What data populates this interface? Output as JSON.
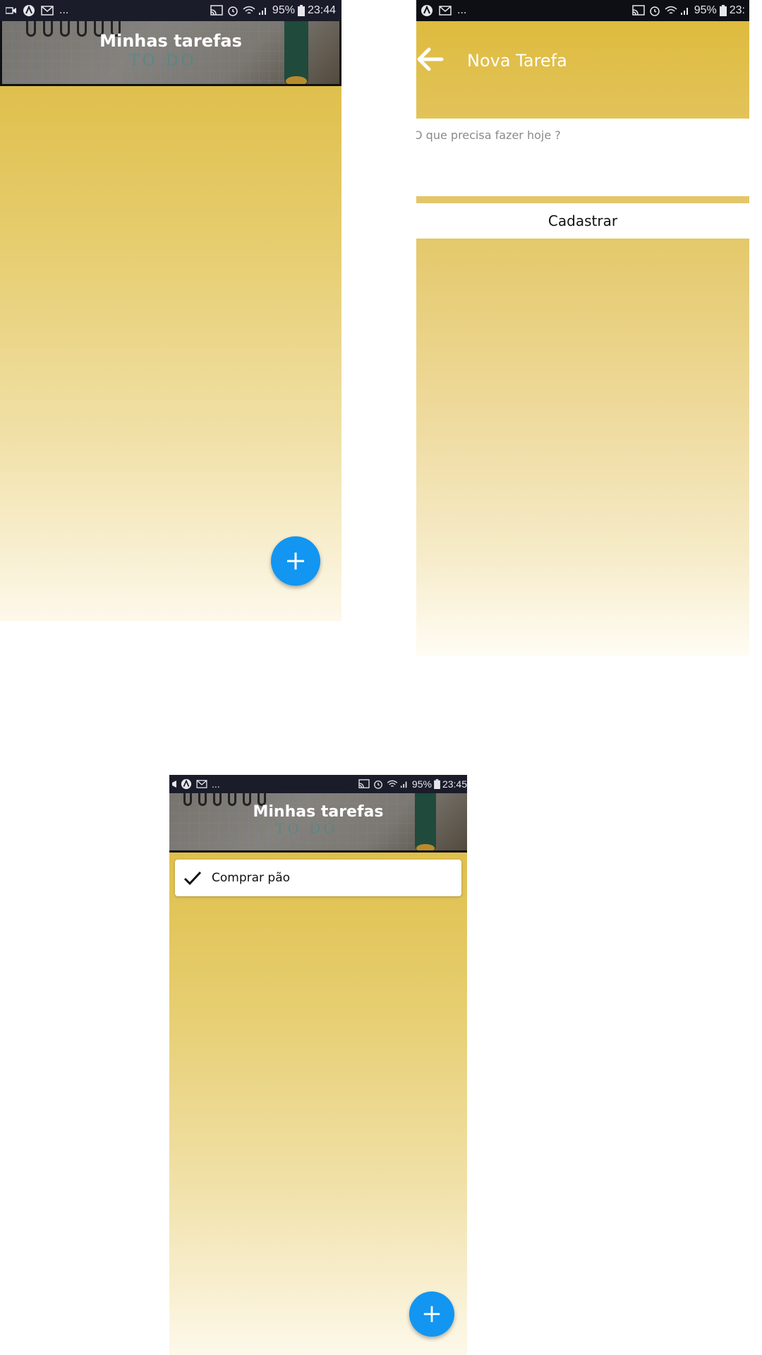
{
  "screens": {
    "list_empty": {
      "status": {
        "left_more": "...",
        "battery": "95%",
        "time": "23:44"
      },
      "header_title": "Minhas tarefas"
    },
    "new_task": {
      "status": {
        "left_more": "...",
        "battery": "95%",
        "time": "23:"
      },
      "appbar_title": "Nova Tarefa",
      "input_placeholder": "O que precisa fazer hoje ?",
      "submit_label": "Cadastrar"
    },
    "list_with_task": {
      "status": {
        "left_more": "...",
        "battery": "95%",
        "time": "23:45"
      },
      "header_title": "Minhas tarefas",
      "tasks": [
        {
          "label": "Comprar pão",
          "done": true
        }
      ]
    }
  },
  "icons": {
    "video": "video-icon",
    "android": "android-icon",
    "mail": "mail-icon",
    "cast": "cast-icon",
    "alarm": "alarm-icon",
    "wifi": "wifi-icon",
    "signal": "signal-icon",
    "battery": "battery-icon",
    "back": "arrow-back-icon",
    "add": "plus-icon",
    "check": "check-icon"
  },
  "colors": {
    "status_bar": "#1a1c2a",
    "gradient_top": "#dfbf4c",
    "gradient_bottom": "#fdf8ea",
    "fab": "#1296f1",
    "header_text": "#ffffff",
    "placeholder": "#8a8a8a"
  }
}
